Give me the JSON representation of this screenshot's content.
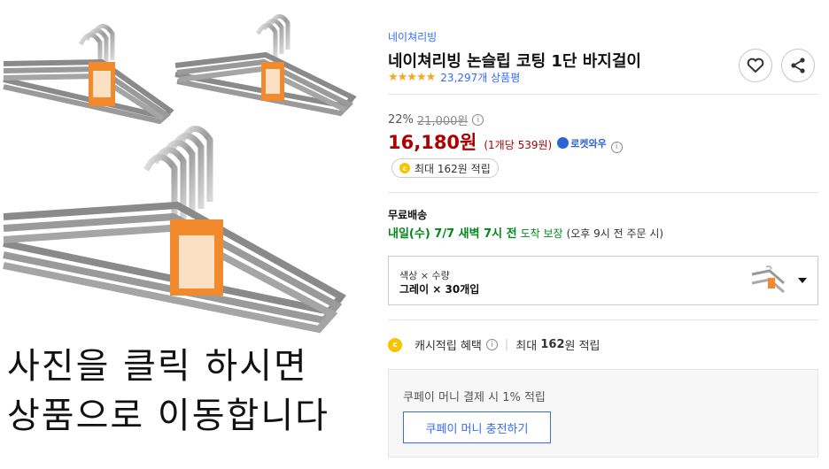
{
  "product": {
    "brand": "네이쳐리빙",
    "title": "네이쳐리빙 논슬립 코팅 1단 바지걸이",
    "stars": "★★★★★",
    "rating_count": "23,297개 상품평"
  },
  "price": {
    "discount_rate": "22%",
    "original_price": "21,000원",
    "sale_price": "16,180원",
    "unit_price": "(1개당 539원)",
    "rocket_label": "로켓와우",
    "info_glyph": "i"
  },
  "cash": {
    "coin_glyph": "c",
    "pill_text": "최대 162원 적립"
  },
  "shipping": {
    "label": "무료배송",
    "date": "내일(수) 7/7 새벽 7시 전",
    "guarantee": "도착 보장",
    "note": "(오후 9시 전 주문 시)"
  },
  "option": {
    "label": "색상 × 수량",
    "value": "그레이 × 30개입"
  },
  "benefit": {
    "label": "캐시적립 혜택",
    "max_prefix": "최대",
    "max_amount": "162",
    "max_suffix": "원 적립"
  },
  "coupay": {
    "text": "쿠페이 머니 결제 시 1% 적립",
    "button": "쿠페이 머니 충전하기"
  },
  "overlay": {
    "line1": "사진을 클릭 하시면",
    "line2": "상품으로 이동합니다"
  },
  "icons": {
    "heart": "heart-icon",
    "share": "share-icon"
  },
  "colors": {
    "link_blue": "#346aff",
    "price_red": "#ae0000",
    "ship_green": "#00891a",
    "star_yellow": "#f5a623",
    "coin_yellow": "#f7c400"
  }
}
